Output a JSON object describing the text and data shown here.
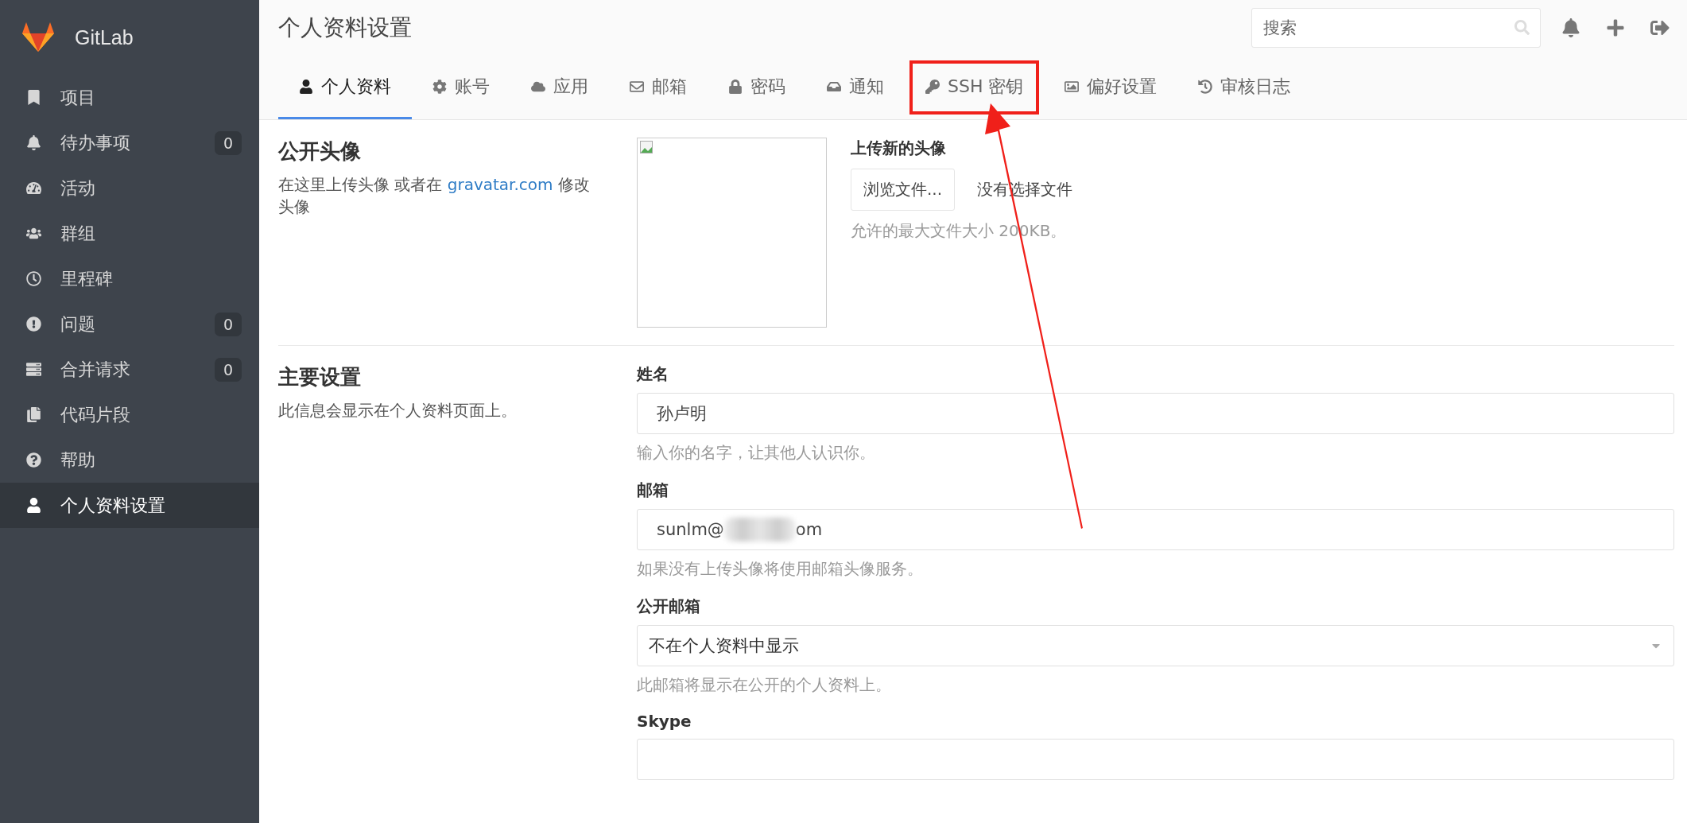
{
  "sidebar": {
    "brand": "GitLab",
    "items": [
      {
        "label": "项目",
        "selected": false
      },
      {
        "label": "待办事项",
        "count": "0",
        "selected": false
      },
      {
        "label": "活动",
        "selected": false
      },
      {
        "label": "群组",
        "selected": false
      },
      {
        "label": "里程碑",
        "selected": false
      },
      {
        "label": "问题",
        "count": "0",
        "selected": false
      },
      {
        "label": "合并请求",
        "count": "0",
        "selected": false
      },
      {
        "label": "代码片段",
        "selected": false
      },
      {
        "label": "帮助",
        "selected": false
      },
      {
        "label": "个人资料设置",
        "selected": true
      }
    ]
  },
  "header": {
    "title": "个人资料设置",
    "search": {
      "placeholder": "搜索"
    }
  },
  "tabs": [
    {
      "label": "个人资料",
      "selected": true,
      "highlighted": false
    },
    {
      "label": "账号",
      "selected": false,
      "highlighted": false
    },
    {
      "label": "应用",
      "selected": false,
      "highlighted": false
    },
    {
      "label": "邮箱",
      "selected": false,
      "highlighted": false
    },
    {
      "label": "密码",
      "selected": false,
      "highlighted": false
    },
    {
      "label": "通知",
      "selected": false,
      "highlighted": false
    },
    {
      "label": "SSH 密钥",
      "selected": false,
      "highlighted": true
    },
    {
      "label": "偏好设置",
      "selected": false,
      "highlighted": false
    },
    {
      "label": "审核日志",
      "selected": false,
      "highlighted": false
    }
  ],
  "avatar_section": {
    "title": "公开头像",
    "description_before": "在这里上传头像 或者在 ",
    "link": "gravatar.com",
    "description_after": " 修改头像",
    "upload_title": "上传新的头像",
    "browse_button": "浏览文件...",
    "no_file": "没有选择文件",
    "hint": "允许的最大文件大小 200KB。"
  },
  "main_section": {
    "title": "主要设置",
    "description": "此信息会显示在个人资料页面上。",
    "fields": [
      {
        "kind": "text",
        "label": "姓名",
        "value": "孙卢明",
        "hint": "输入你的名字，让其他人认识你。"
      },
      {
        "kind": "redacted",
        "label": "邮箱",
        "value_start": "sunlm@",
        "value_end": "om",
        "hint": "如果没有上传头像将使用邮箱头像服务。"
      },
      {
        "kind": "select",
        "label": "公开邮箱",
        "value": "不在个人资料中显示",
        "hint": "此邮箱将显示在公开的个人资料上。"
      },
      {
        "kind": "text",
        "label": "Skype"
      }
    ]
  }
}
